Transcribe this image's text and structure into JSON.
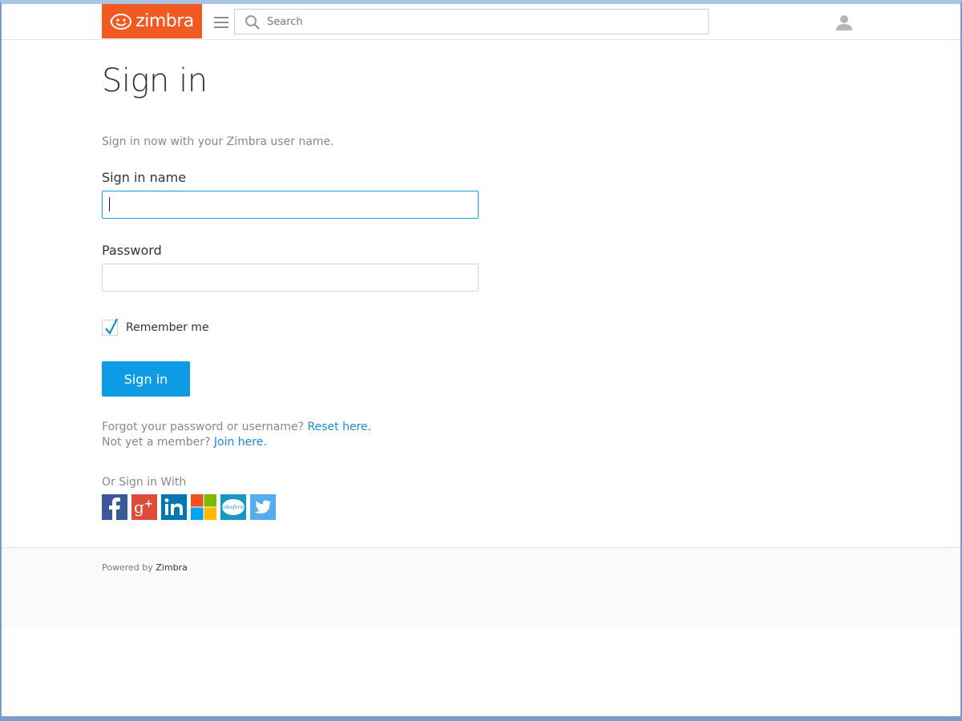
{
  "header": {
    "logo_text": "zimbra",
    "brand_color": "#f15a22",
    "search": {
      "placeholder": "Search",
      "value": ""
    },
    "icons": [
      "hamburger-menu-icon",
      "search-icon",
      "user-icon"
    ]
  },
  "main": {
    "title": "Sign in",
    "intro": "Sign in now with your Zimbra user name.",
    "username": {
      "label": "Sign in name",
      "value": ""
    },
    "password": {
      "label": "Password",
      "value": ""
    },
    "remember": {
      "label": "Remember me",
      "checked": true
    },
    "submit_label": "Sign in",
    "accent_color": "#0d9ce3",
    "forgot": {
      "text": "Forgot your password or username?",
      "link": "Reset here."
    },
    "join": {
      "text": "Not yet a member?",
      "link": "Join here."
    },
    "or_sign_in_with": "Or Sign in With",
    "social": [
      {
        "name": "facebook",
        "color": "#3b5998"
      },
      {
        "name": "google-plus",
        "color": "#dd4b39"
      },
      {
        "name": "linkedin",
        "color": "#0077b5"
      },
      {
        "name": "microsoft",
        "color": "#f25022"
      },
      {
        "name": "salesforce",
        "color": "#1798c1",
        "text": "salesforce"
      },
      {
        "name": "twitter",
        "color": "#55acee"
      }
    ]
  },
  "footer": {
    "powered_by": "Powered by",
    "brand": "Zimbra"
  }
}
